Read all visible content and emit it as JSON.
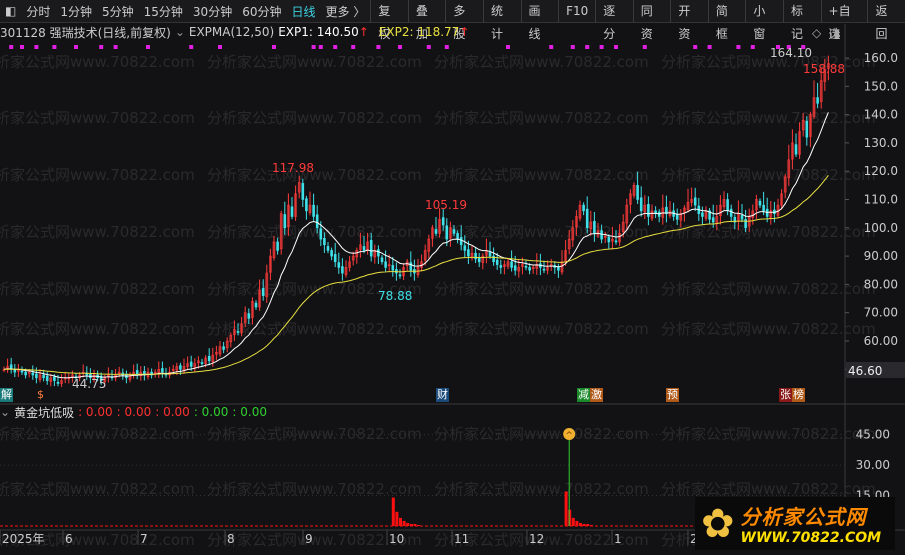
{
  "toolbar": {
    "left_icon": "panel-toggle-icon",
    "periods": [
      "分时",
      "1分钟",
      "5分钟",
      "15分钟",
      "30分钟",
      "60分钟",
      "日线",
      "更多 〉"
    ],
    "active_period": "日线",
    "buttons": [
      "复权",
      "叠加",
      "多股",
      "统计",
      "画线",
      "F10",
      "逐分",
      "同资",
      "开资",
      "简框",
      "小窗",
      "标记",
      "+自选",
      "返回"
    ]
  },
  "legend": {
    "stock": "301128 强瑞技术(日线,前复权)",
    "indicator": "EXPMA(12,50)",
    "exp1_label": "EXP1: 140.50",
    "exp2_label": "EXP2: 118.77",
    "up_arrow": "↑"
  },
  "colors": {
    "up": "#ff3a3a",
    "down": "#3fe0e8",
    "exp1": "#ffffff",
    "exp2": "#e8e040",
    "marker": "#e020e0",
    "bar": "#ff1010",
    "signal": "#30d030",
    "accent": "#3fd3e0"
  },
  "chart_data": [
    {
      "type": "candlestick",
      "title": "301128 强瑞技术(日线,前复权)",
      "ylim": [
        44,
        166
      ],
      "y_ticks": [
        "160.0",
        "150.0",
        "140.0",
        "130.0",
        "120.0",
        "110.0",
        "100.0",
        "90.00",
        "80.00",
        "70.00",
        "60.00",
        "50.00"
      ],
      "y_tick_values": [
        160,
        150,
        140,
        130,
        120,
        110,
        100,
        90,
        80,
        70,
        60,
        50
      ],
      "current_price_label": "46.60",
      "x_ticks": [
        "2025年",
        "6",
        "7",
        "8",
        "9",
        "10",
        "11",
        "12",
        "1",
        "2"
      ],
      "annotations": {
        "high1": "117.98",
        "high2": "105.19",
        "low1": "78.88",
        "low0": "44.75",
        "max": "164.10",
        "last": "158.88"
      },
      "series": [
        {
          "name": "EXP1",
          "period": 12
        },
        {
          "name": "EXP2",
          "period": 50
        }
      ],
      "close": [
        50,
        51,
        50,
        49,
        50,
        49,
        48,
        49,
        48,
        47,
        48,
        47,
        46,
        47,
        46,
        45,
        46,
        47,
        47,
        48,
        47,
        48,
        49,
        48,
        47,
        48,
        47,
        46,
        47,
        48,
        47,
        48,
        49,
        48,
        47,
        48,
        49,
        48,
        49,
        48,
        49,
        48,
        49,
        50,
        49,
        48,
        49,
        50,
        51,
        50,
        51,
        52,
        51,
        52,
        53,
        52,
        54,
        53,
        55,
        56,
        58,
        57,
        60,
        62,
        64,
        63,
        66,
        70,
        68,
        74,
        72,
        78,
        76,
        84,
        90,
        95,
        92,
        105,
        100,
        108,
        104,
        112,
        116,
        110,
        106,
        108,
        104,
        100,
        96,
        94,
        92,
        90,
        88,
        86,
        84,
        86,
        88,
        90,
        92,
        94,
        92,
        95,
        90,
        92,
        90,
        88,
        86,
        87,
        85,
        84,
        83,
        86,
        88,
        85,
        84,
        86,
        88,
        92,
        96,
        100,
        98,
        103,
        101,
        96,
        100,
        98,
        96,
        94,
        92,
        90,
        91,
        89,
        88,
        90,
        92,
        90,
        88,
        87,
        86,
        87,
        88,
        86,
        85,
        86,
        87,
        86,
        85,
        86,
        87,
        86,
        85,
        86,
        87,
        86,
        85,
        88,
        92,
        96,
        100,
        104,
        108,
        106,
        100,
        102,
        98,
        99,
        96,
        97,
        95,
        96,
        95,
        98,
        102,
        108,
        112,
        115,
        110,
        106,
        108,
        104,
        106,
        105,
        104,
        107,
        105,
        106,
        104,
        103,
        105,
        107,
        109,
        110,
        108,
        105,
        104,
        106,
        103,
        102,
        104,
        108,
        110,
        106,
        104,
        102,
        105,
        103,
        100,
        104,
        106,
        110,
        108,
        106,
        104,
        106,
        105,
        108,
        112,
        118,
        124,
        130,
        126,
        134,
        138,
        132,
        140,
        146,
        144,
        152,
        156,
        158
      ]
    },
    {
      "type": "bar",
      "title": "黄金坑低吸",
      "values_label": [
        ": 0.00",
        ": 0.00",
        ": 0.00",
        ": 0.00",
        ": 0.00"
      ],
      "ylim": [
        0,
        55
      ],
      "y_ticks": [
        "45.00",
        "30.00",
        "15.00"
      ],
      "y_tick_values": [
        45,
        30,
        15
      ],
      "spikes": [
        {
          "index": 108,
          "values": [
            14,
            7,
            4,
            2.5,
            1.5,
            1,
            1,
            0.5
          ]
        },
        {
          "index": 156,
          "values": [
            17,
            8,
            4,
            2.5,
            1.5,
            1,
            1,
            0.5
          ]
        }
      ],
      "signal_index": 157
    }
  ],
  "events": [
    {
      "label": "解",
      "color": "#1a7a7a"
    },
    {
      "label": "$",
      "color": "#ff8040"
    },
    {
      "label": "财",
      "color": "#1a4a7a"
    },
    {
      "label": "减",
      "color": "#1a8a2a"
    },
    {
      "label": "激",
      "color": "#b05a1a"
    },
    {
      "label": "预",
      "color": "#b05a1a"
    },
    {
      "label": "张",
      "color": "#8a1a1a"
    },
    {
      "label": "榜",
      "color": "#b05a1a"
    }
  ],
  "watermark": "分析家公式网www.70822.com",
  "logo": {
    "line1": "分析家公式网",
    "line2": "WWW.70822.COM"
  }
}
